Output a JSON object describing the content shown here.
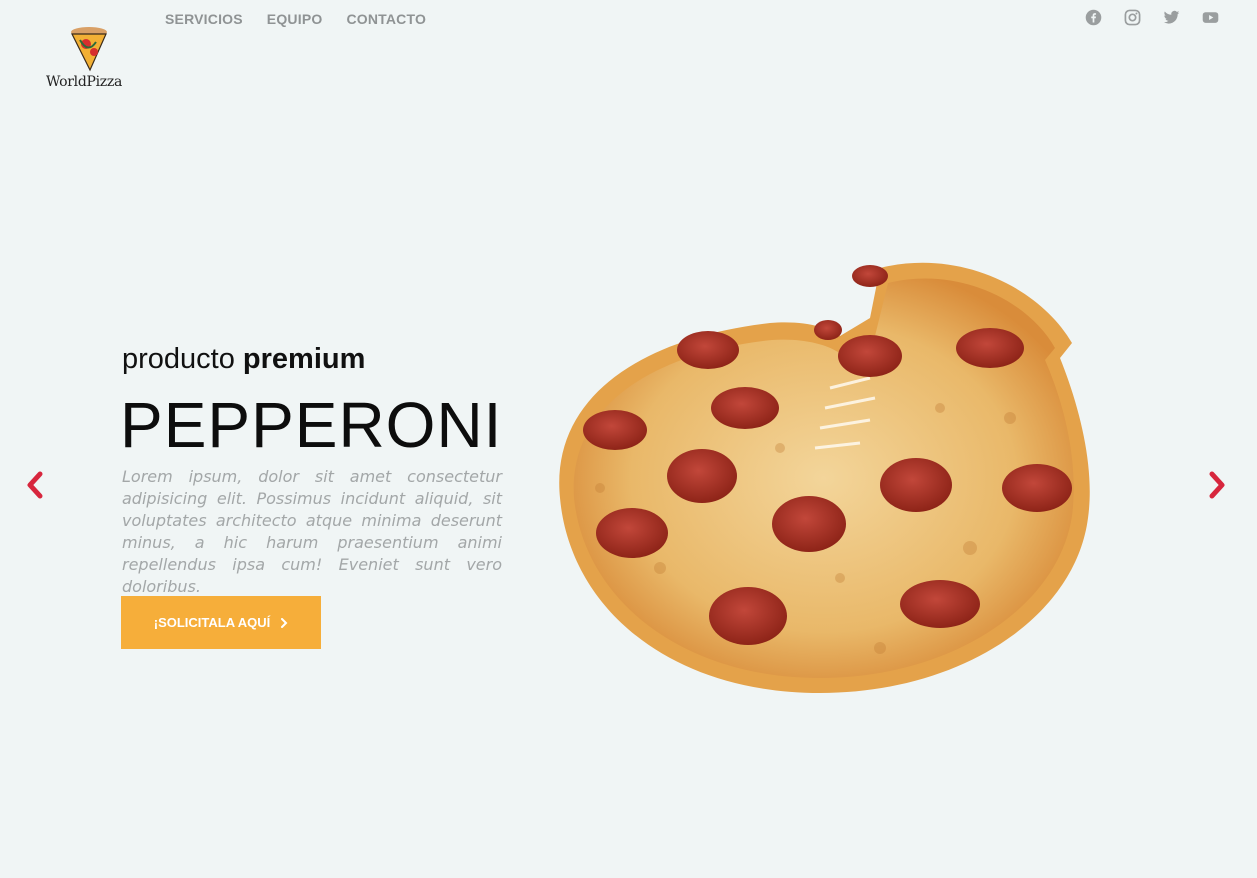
{
  "brand": {
    "name": "WorldPizza"
  },
  "nav": {
    "items": [
      "SERVICIOS",
      "EQUIPO",
      "CONTACTO"
    ]
  },
  "social": [
    "facebook-icon",
    "instagram-icon",
    "twitter-icon",
    "youtube-icon"
  ],
  "hero": {
    "subtitle_regular": "producto ",
    "subtitle_bold": "premium",
    "title": "PEPPERONI",
    "description": "Lorem ipsum, dolor sit amet consectetur adipisicing elit. Possimus incidunt aliquid, sit voluptates architecto atque minima deserunt minus, a hic harum praesentium animi repellendus ipsa cum! Eveniet sunt vero doloribus.",
    "cta_label": "¡SOLICITALA AQUÍ"
  },
  "colors": {
    "background": "#f0f5f5",
    "accent": "#f6ae3a",
    "arrow": "#d7263d",
    "nav_text": "#8f9394"
  }
}
